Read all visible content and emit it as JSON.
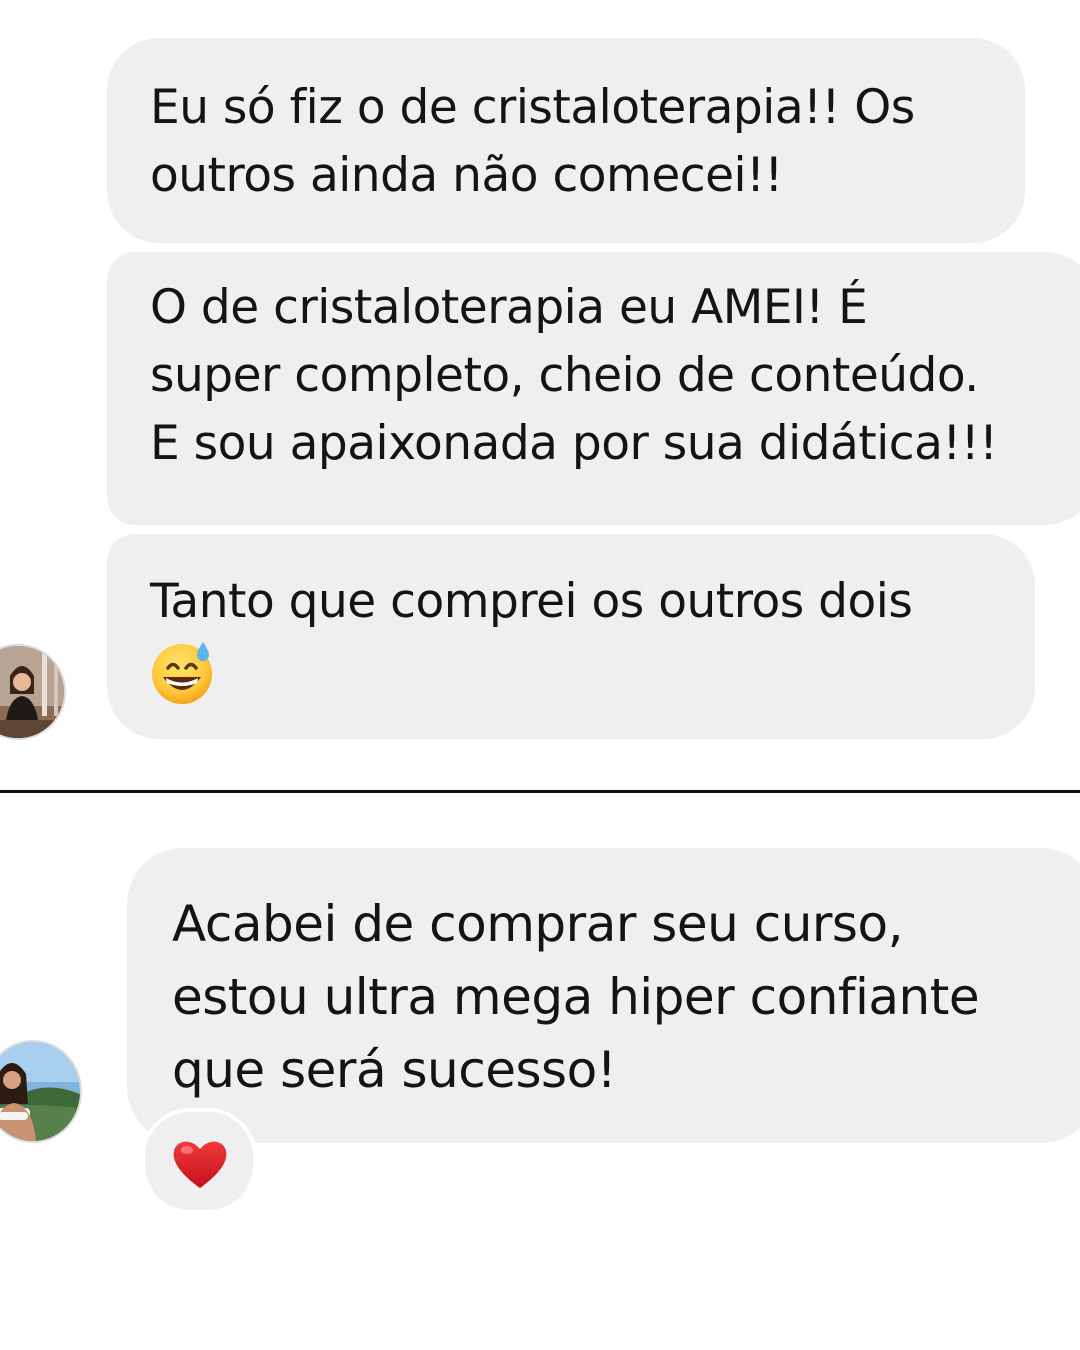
{
  "conversation_1": {
    "messages": [
      {
        "lines": [
          "Eu só fiz o de cristaloterapia!! Os",
          "outros ainda não comecei!!"
        ]
      },
      {
        "lines": [
          "O de cristaloterapia eu AMEI! É",
          "super completo, cheio de conteúdo.",
          "E sou apaixonada por sua didática!!!"
        ]
      },
      {
        "lines": [
          "Tanto que comprei os outros dois"
        ],
        "emoji": "grinning-face-with-sweat-emoji"
      }
    ],
    "avatar": "user-avatar-photo"
  },
  "conversation_2": {
    "messages": [
      {
        "lines": [
          "Acabei de comprar seu curso,",
          "estou ultra mega hiper confiante",
          "que será sucesso!"
        ]
      }
    ],
    "reaction": "red-heart-emoji",
    "avatar": "user-avatar-photo"
  },
  "colors": {
    "bubble": "#efefef",
    "divider": "#111111",
    "heart": "#e0162b"
  }
}
